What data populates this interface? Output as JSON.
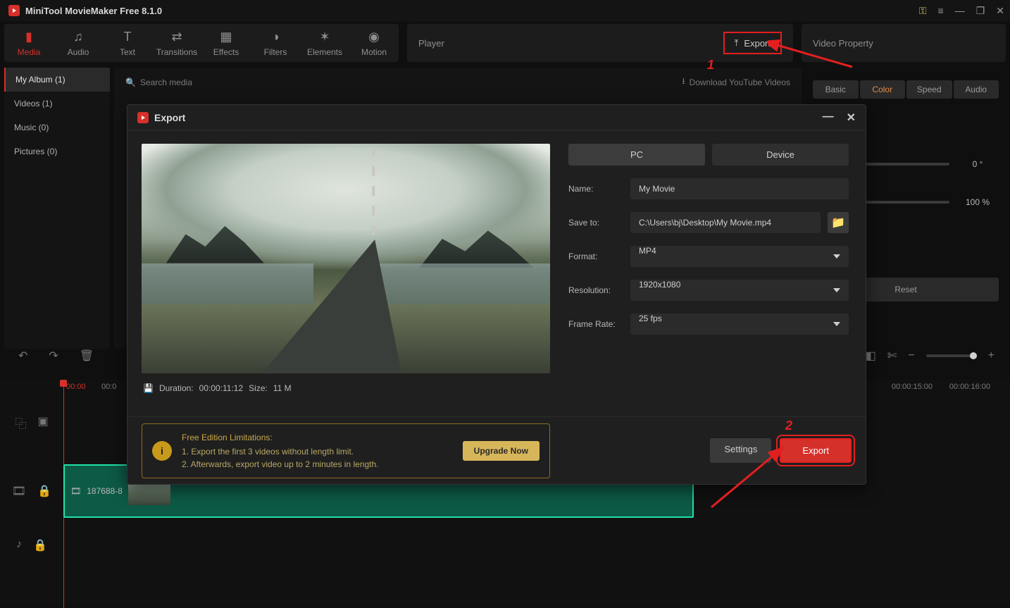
{
  "app": {
    "title": "MiniTool MovieMaker Free 8.1.0"
  },
  "toolbar": {
    "media": "Media",
    "audio": "Audio",
    "text": "Text",
    "transitions": "Transitions",
    "effects": "Effects",
    "filters": "Filters",
    "elements": "Elements",
    "motion": "Motion"
  },
  "player": {
    "title": "Player",
    "export_label": "Export"
  },
  "video_property": {
    "title": "Video Property",
    "tabs": {
      "basic": "Basic",
      "color": "Color",
      "speed": "Speed",
      "audio": "Audio"
    },
    "rotation": "0 °",
    "scale": "100 %",
    "reset": "Reset"
  },
  "sidebar": {
    "items": [
      {
        "label": "My Album (1)"
      },
      {
        "label": "Videos (1)"
      },
      {
        "label": "Music (0)"
      },
      {
        "label": "Pictures (0)"
      }
    ]
  },
  "media_header": {
    "search_placeholder": "Search media",
    "download_label": "Download YouTube Videos"
  },
  "timeline": {
    "left_ticks": [
      "00:00",
      "00:0"
    ],
    "right_ticks": [
      "00:00:15:00",
      "00:00:16:00"
    ],
    "clip_name": "187688-8"
  },
  "export_dialog": {
    "title": "Export",
    "tabs": {
      "pc": "PC",
      "device": "Device"
    },
    "fields": {
      "name_label": "Name:",
      "name_value": "My Movie",
      "save_label": "Save to:",
      "save_value": "C:\\Users\\bj\\Desktop\\My Movie.mp4",
      "format_label": "Format:",
      "format_value": "MP4",
      "resolution_label": "Resolution:",
      "resolution_value": "1920x1080",
      "framerate_label": "Frame Rate:",
      "framerate_value": "25 fps"
    },
    "info": {
      "duration_label": "Duration:",
      "duration_value": "00:00:11:12",
      "size_label": "Size:",
      "size_value": "11 M"
    },
    "limitations": {
      "title": "Free Edition Limitations:",
      "line1": "1. Export the first 3 videos without length limit.",
      "line2": "2. Afterwards, export video up to 2 minutes in length.",
      "upgrade": "Upgrade Now"
    },
    "buttons": {
      "settings": "Settings",
      "export": "Export"
    }
  },
  "annotations": {
    "one": "1",
    "two": "2"
  }
}
